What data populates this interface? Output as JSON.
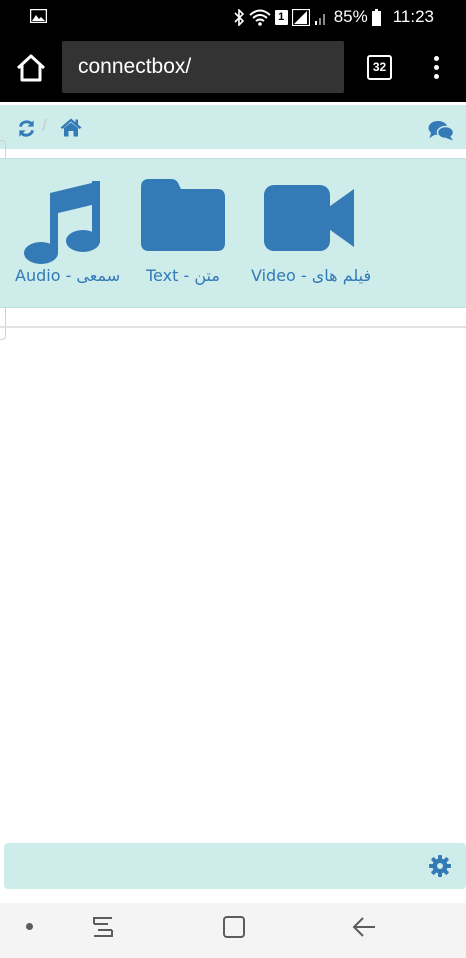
{
  "status_bar": {
    "sim_slot": "1",
    "battery": "85%",
    "time": "11:23"
  },
  "browser": {
    "url": "connectbox/",
    "tab_count": "32"
  },
  "nav": {
    "breadcrumb_separator": "/"
  },
  "media_categories": [
    {
      "label": "Audio - سمعی",
      "icon": "music-icon"
    },
    {
      "label": "Text - متن",
      "icon": "folder-icon"
    },
    {
      "label": "Video - فیلم های",
      "icon": "video-camera-icon"
    }
  ],
  "colors": {
    "accent": "#337ab7",
    "panel_bg": "#cdecea",
    "chrome_bg": "#000000"
  }
}
